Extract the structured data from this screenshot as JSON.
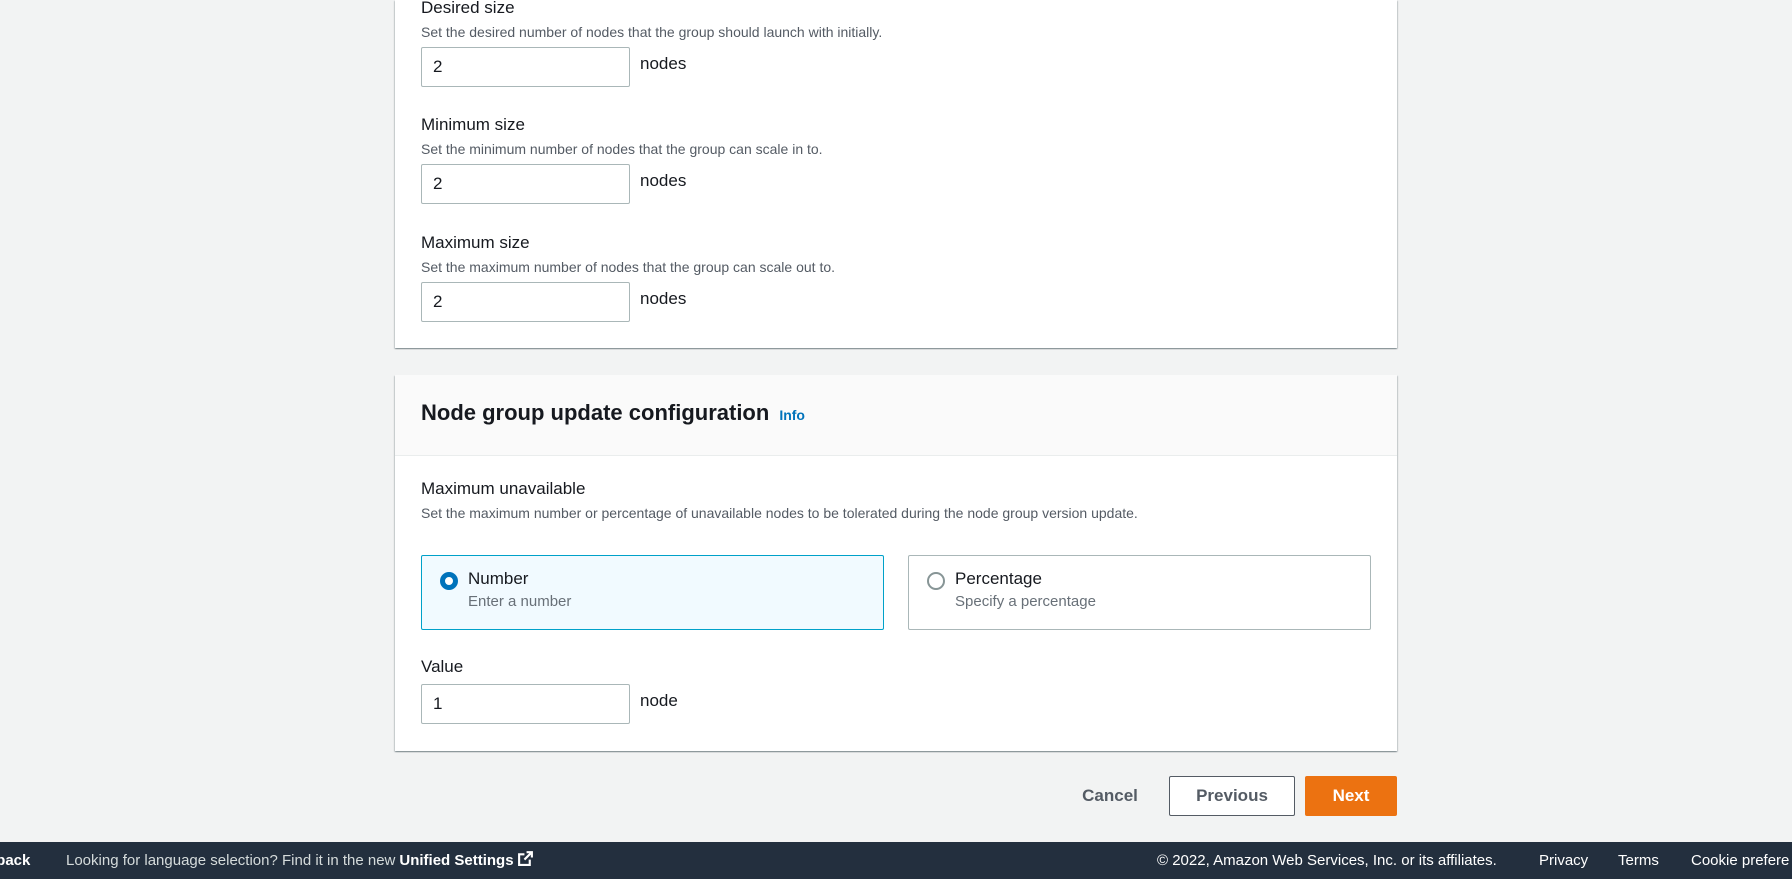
{
  "scaling": {
    "desired": {
      "label": "Desired size",
      "description": "Set the desired number of nodes that the group should launch with initially.",
      "value": "2",
      "unit": "nodes"
    },
    "minimum": {
      "label": "Minimum size",
      "description": "Set the minimum number of nodes that the group can scale in to.",
      "value": "2",
      "unit": "nodes"
    },
    "maximum": {
      "label": "Maximum size",
      "description": "Set the maximum number of nodes that the group can scale out to.",
      "value": "2",
      "unit": "nodes"
    }
  },
  "update_config": {
    "title": "Node group update configuration",
    "info_link": "Info",
    "max_unavailable_label": "Maximum unavailable",
    "max_unavailable_description": "Set the maximum number or percentage of unavailable nodes to be tolerated during the node group version update.",
    "options": [
      {
        "label": "Number",
        "description": "Enter a number",
        "selected": true
      },
      {
        "label": "Percentage",
        "description": "Specify a percentage",
        "selected": false
      }
    ],
    "value_label": "Value",
    "value": "1",
    "value_unit": "node"
  },
  "actions": {
    "cancel": "Cancel",
    "previous": "Previous",
    "next": "Next"
  },
  "footer": {
    "feedback": "lback",
    "language_prompt": "Looking for language selection? Find it in the new",
    "unified_settings": "Unified Settings",
    "copyright": "© 2022, Amazon Web Services, Inc. or its affiliates.",
    "privacy": "Privacy",
    "terms": "Terms",
    "cookie": "Cookie prefere"
  },
  "colors": {
    "primary_button": "#ec7211",
    "link": "#0073bb",
    "selected_tile_border": "#00a1c9",
    "footer_bg": "#232f3e"
  }
}
